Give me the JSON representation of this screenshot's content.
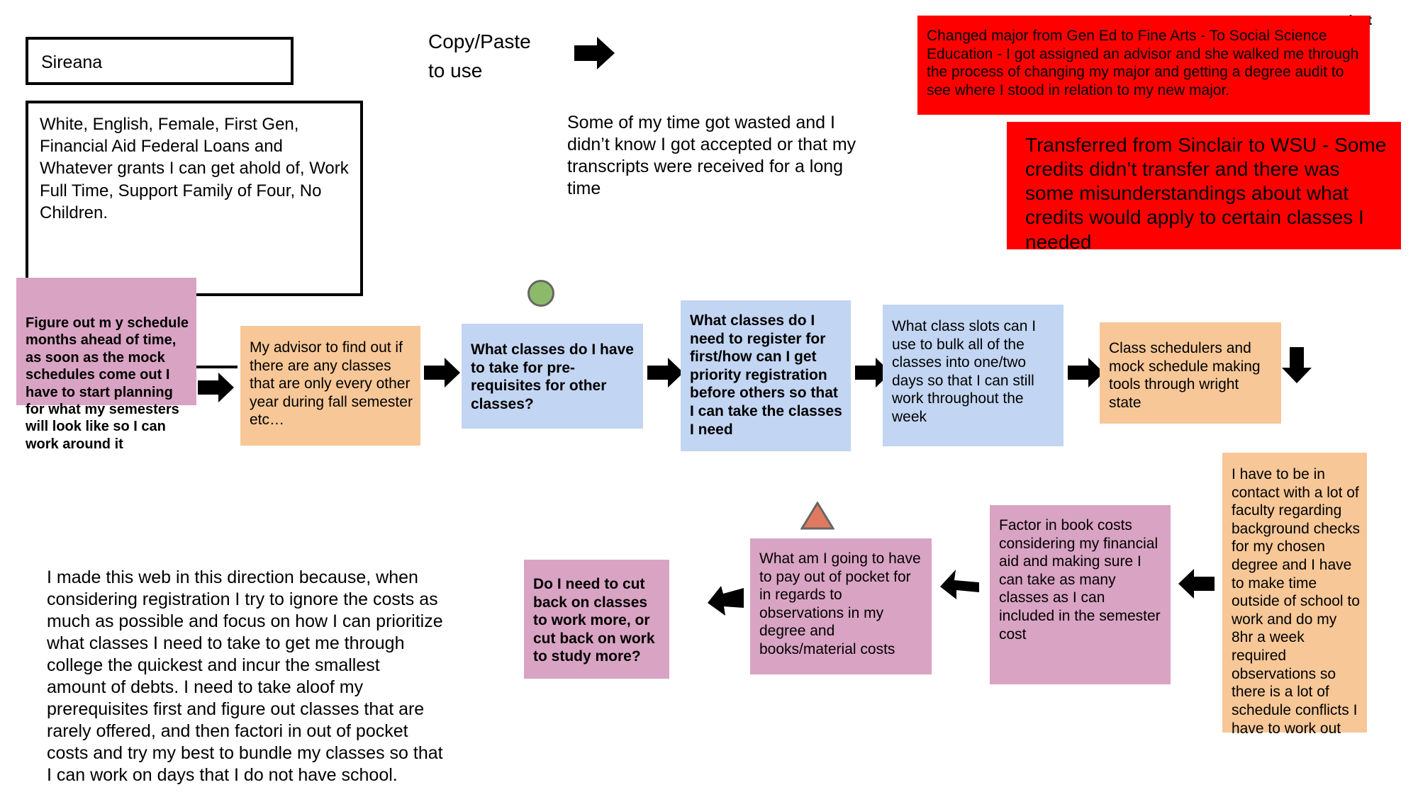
{
  "meta": {
    "bg_color": "#ffffff",
    "palette": {
      "pink": "#d9a3c3",
      "orange": "#f7c797",
      "blue": "#c2d5f2",
      "red": "#ff0000",
      "green_circle": "#8cba6a",
      "salmon_triangle": "#e07a5f",
      "outline": "#000000"
    }
  },
  "name_box": {
    "label": "Sireana"
  },
  "demographics_box": {
    "text": "White, English, Female, First Gen, Financial Aid Federal Loans and Whatever grants I can get ahold of, Work Full Time, Support Family of Four, No Children."
  },
  "instruction": {
    "line1": "Copy/Paste",
    "line2": "to use"
  },
  "notes": {
    "wasted_time": "Some of my time got wasted and I didn’t know I got accepted or that my transcripts were received for a long time",
    "direction_explanation": "I made this web in this direction because, when considering registration I try to ignore the costs as much as possible and focus on how I can prioritize what classes I need to take to get me through college the quickest and incur the smallest amount of debts. I need to take aloof my prerequisites first and figure out classes that are rarely offered, and then factori in out of pocket costs and try my best to bundle my classes so that I can work on days that I do not have school.",
    "partial_label": "dest"
  },
  "red_boxes": [
    {
      "id": "changed-major",
      "text": "Changed major from Gen Ed to Fine Arts - To Social Science Education - I got assigned an advisor and she walked me through the process of changing my major and getting a degree audit to see where I stood in relation to my new major."
    },
    {
      "id": "transferred",
      "text": "Transferred from Sinclair to WSU - Some credits didn’t transfer and there was some misunderstandings about what credits would apply to certain classes I needed"
    }
  ],
  "flow_nodes": [
    {
      "id": "figure-out-schedule",
      "color": "pink",
      "bold": true,
      "text": "Figure out m y schedule months ahead of time, as soon as the mock schedules come out I have to start planning for what my semesters will look like so I can work around it"
    },
    {
      "id": "my-advisor",
      "color": "orange",
      "bold": false,
      "text": "My advisor to find out if there are any classes that are only every other year during fall semester etc…"
    },
    {
      "id": "prerequisites",
      "color": "blue",
      "bold": true,
      "text": "What classes do I have to take for pre-requisites for other classes?"
    },
    {
      "id": "priority-registration",
      "color": "blue",
      "bold": true,
      "text": "What classes do I need to register for first/how can I get priority registration before others so that I can take the classes I need"
    },
    {
      "id": "class-slots",
      "color": "blue",
      "bold": false,
      "text": "What class slots can I use to bulk all of the classes into one/two days so that I can still work throughout the week"
    },
    {
      "id": "class-schedulers",
      "color": "orange",
      "bold": false,
      "text": "Class schedulers and mock schedule making tools through wright state"
    },
    {
      "id": "faculty-contact",
      "color": "orange",
      "bold": false,
      "text": "I have to be in contact with a lot of faculty regarding background checks for my chosen degree and I have to make time outside of school to work and do my 8hr a week required observations so there is a lot of schedule conflicts I have to work out"
    },
    {
      "id": "book-costs",
      "color": "pink",
      "bold": false,
      "text": "Factor in book costs considering my financial aid and making sure I can take as many classes as I can included in the semester cost"
    },
    {
      "id": "out-of-pocket",
      "color": "pink",
      "bold": false,
      "text": "What am I going to have to pay out of pocket for in regards to observations in my degree and books/material costs"
    },
    {
      "id": "cut-back",
      "color": "pink",
      "bold": true,
      "text": "Do I need to cut back on classes to work more, or cut back on work to study more?"
    }
  ]
}
